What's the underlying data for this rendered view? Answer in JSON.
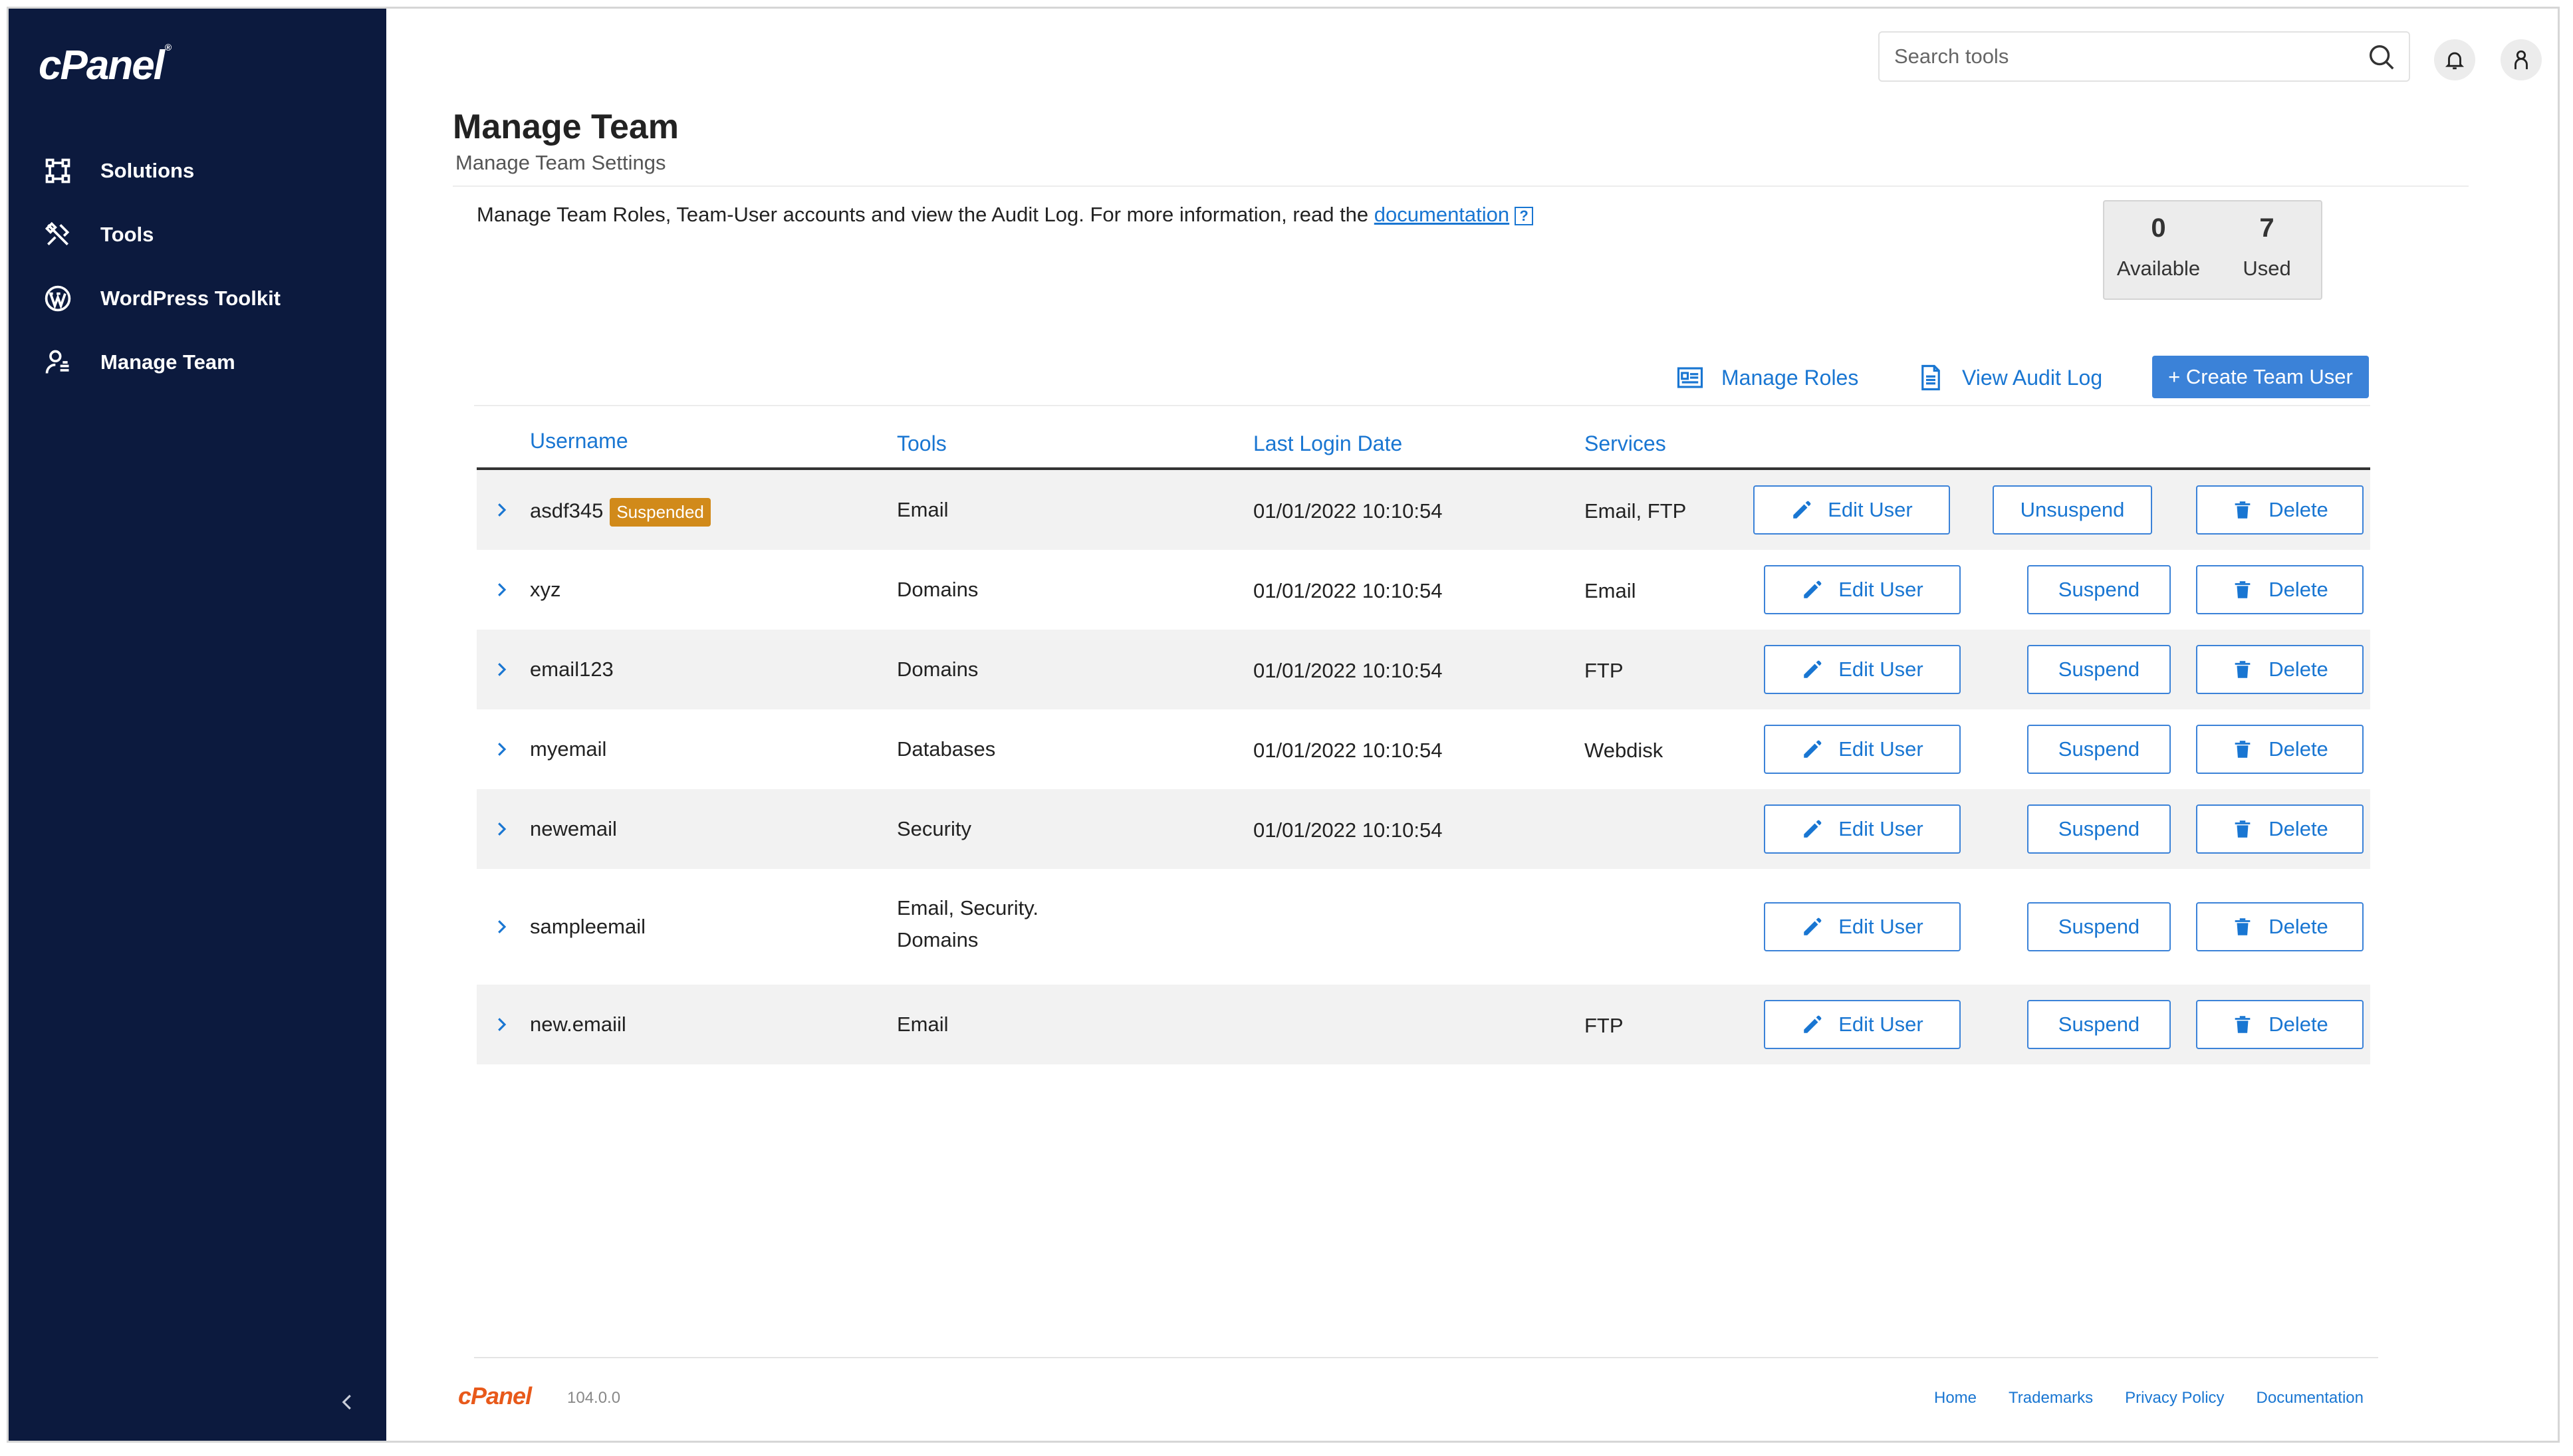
{
  "brand": {
    "logo": "cPanel",
    "logo_mark": "®",
    "footer_logo": "cPanel",
    "version": "104.0.0",
    "accent": "#1976d2",
    "sidebar_bg": "#0c1a3e",
    "badge_color": "#d18a1a"
  },
  "sidebar": {
    "items": [
      {
        "label": "Solutions",
        "icon": "solutions-icon"
      },
      {
        "label": "Tools",
        "icon": "tools-icon"
      },
      {
        "label": "WordPress Toolkit",
        "icon": "wordpress-icon"
      },
      {
        "label": "Manage Team",
        "icon": "team-icon"
      }
    ],
    "collapse_icon": "chevron-left-icon"
  },
  "header": {
    "search_placeholder": "Search tools"
  },
  "page": {
    "title": "Manage Team",
    "subtitle": "Manage Team Settings",
    "intro_text": "Manage Team Roles, Team-User accounts and view the Audit Log. For more information, read the ",
    "intro_link": "documentation",
    "help_glyph": "?"
  },
  "stats": [
    {
      "value": "0",
      "label": "Available"
    },
    {
      "value": "7",
      "label": "Used"
    }
  ],
  "actions": {
    "manage_roles": "Manage Roles",
    "view_audit_log": "View Audit Log",
    "create_team_user": "+ Create Team User"
  },
  "table": {
    "columns": [
      "Username",
      "Tools",
      "Last Login Date",
      "Services"
    ],
    "rows": [
      {
        "username": "asdf345",
        "badge": "Suspended",
        "tools": "Email",
        "tools2": "",
        "last_login": "01/01/2022 10:10:54",
        "services": "Email, FTP",
        "edit": "Edit User",
        "toggle": "Unsuspend",
        "delete": "Delete"
      },
      {
        "username": "xyz",
        "badge": "",
        "tools": "Domains",
        "tools2": "",
        "last_login": "01/01/2022 10:10:54",
        "services": "Email",
        "edit": "Edit User",
        "toggle": "Suspend",
        "delete": "Delete"
      },
      {
        "username": "email123",
        "badge": "",
        "tools": "Domains",
        "tools2": "",
        "last_login": "01/01/2022 10:10:54",
        "services": "FTP",
        "edit": "Edit User",
        "toggle": "Suspend",
        "delete": "Delete"
      },
      {
        "username": "myemail",
        "badge": "",
        "tools": "Databases",
        "tools2": "",
        "last_login": "01/01/2022 10:10:54",
        "services": "Webdisk",
        "edit": "Edit User",
        "toggle": "Suspend",
        "delete": "Delete"
      },
      {
        "username": "newemail",
        "badge": "",
        "tools": "Security",
        "tools2": "",
        "last_login": "01/01/2022 10:10:54",
        "services": "",
        "edit": "Edit User",
        "toggle": "Suspend",
        "delete": "Delete"
      },
      {
        "username": "sampleemail",
        "badge": "",
        "tools": "Email, Security.",
        "tools2": "Domains",
        "last_login": "",
        "services": "",
        "edit": "Edit User",
        "toggle": "Suspend",
        "delete": "Delete"
      },
      {
        "username": "new.emaiil",
        "badge": "",
        "tools": "Email",
        "tools2": "",
        "last_login": "",
        "services": "FTP",
        "edit": "Edit User",
        "toggle": "Suspend",
        "delete": "Delete"
      }
    ]
  },
  "footer": {
    "links": [
      "Home",
      "Trademarks",
      "Privacy Policy",
      "Documentation"
    ]
  }
}
